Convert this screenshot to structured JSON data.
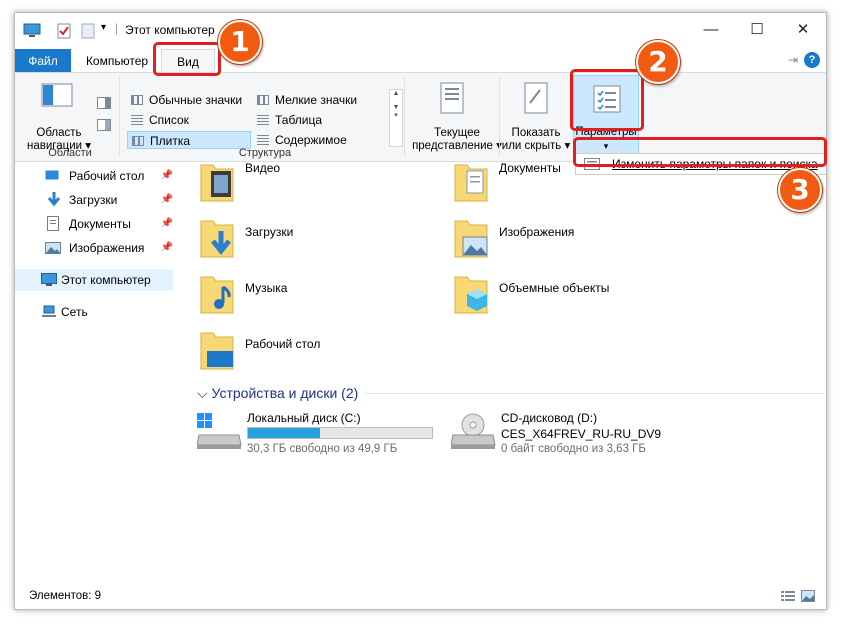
{
  "window": {
    "title": "Этот компьютер"
  },
  "tabs": {
    "file": "Файл",
    "computer": "Компьютер",
    "view": "Вид"
  },
  "ribbon": {
    "areas": {
      "nav_pane_line1": "Область",
      "nav_pane_line2": "навигации",
      "group_label": "Области"
    },
    "structure": {
      "items": [
        "Обычные значки",
        "Мелкие значки",
        "Список",
        "Таблица",
        "Плитка",
        "Содержимое"
      ],
      "selected": "Плитка",
      "group_label": "Структура"
    },
    "current_view": {
      "line1": "Текущее",
      "line2": "представление"
    },
    "show_hide": {
      "line1": "Показать",
      "line2": "или скрыть"
    },
    "options": {
      "label": "Параметры"
    },
    "options_menu": {
      "item": "Изменить параметры папок и поиска"
    }
  },
  "annotations": {
    "step1": "1",
    "step2": "2",
    "step3": "3",
    "color": "#e1201e",
    "badge_color": "#f25a12"
  },
  "nav": {
    "items": [
      "Рабочий стол",
      "Загрузки",
      "Документы",
      "Изображения",
      "Этот компьютер",
      "Сеть"
    ]
  },
  "folders": [
    "Видео",
    "Документы",
    "Загрузки",
    "Изображения",
    "Музыка",
    "Объемные объекты",
    "Рабочий стол"
  ],
  "devices": {
    "header": "Устройства и диски (2)",
    "drives": [
      {
        "name": "Локальный диск (C:)",
        "free": "30,3 ГБ свободно из 49,9 ГБ",
        "used_fraction": 0.39
      },
      {
        "name": "CD-дисковод (D:)",
        "label": "CES_X64FREV_RU-RU_DV9",
        "free": "0 байт свободно из 3,63 ГБ"
      }
    ]
  },
  "status": {
    "items": "Элементов: 9"
  },
  "colors": {
    "accent": "#1979ca",
    "selection": "#cce8ff",
    "drive_fill": "#26a0da",
    "folder": "#f8d775"
  }
}
